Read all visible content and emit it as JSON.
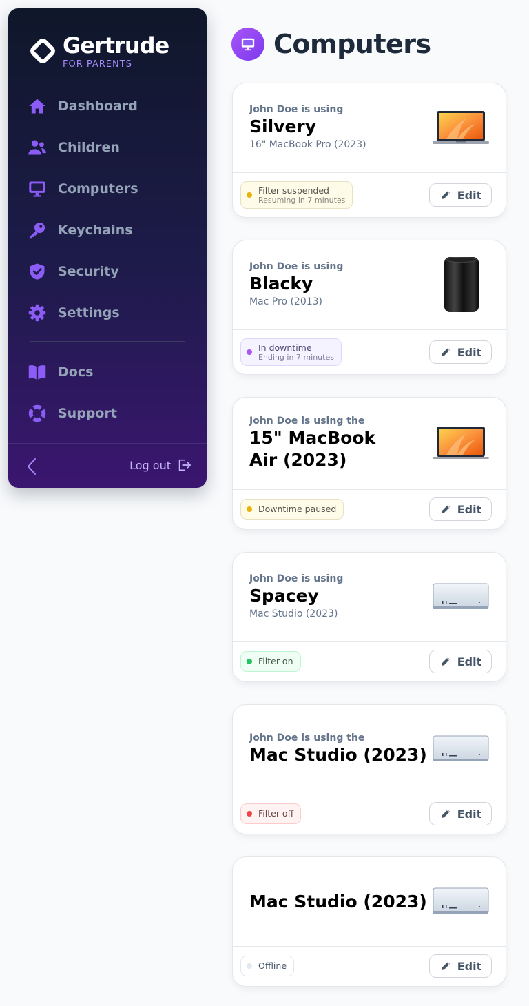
{
  "brand": {
    "name": "Gertrude",
    "tagline": "FOR PARENTS"
  },
  "nav": {
    "items": [
      {
        "label": "Dashboard",
        "icon": "home-icon"
      },
      {
        "label": "Children",
        "icon": "users-icon"
      },
      {
        "label": "Computers",
        "icon": "computer-icon"
      },
      {
        "label": "Keychains",
        "icon": "key-icon"
      },
      {
        "label": "Security",
        "icon": "shield-icon"
      },
      {
        "label": "Settings",
        "icon": "gear-icon"
      }
    ],
    "secondary": [
      {
        "label": "Docs",
        "icon": "book-icon"
      },
      {
        "label": "Support",
        "icon": "lifebuoy-icon"
      }
    ],
    "logout_label": "Log out"
  },
  "page": {
    "title": "Computers"
  },
  "computers": [
    {
      "using": "John Doe is using",
      "name": "Silvery",
      "model": "16\" MacBook Pro (2023)",
      "image": "macbook-pro-image",
      "status": {
        "title": "Filter suspended",
        "sub": "Resuming in 7 minutes",
        "color": "#eab308"
      },
      "edit_label": "Edit"
    },
    {
      "using": "John Doe is using",
      "name": "Blacky",
      "model": "Mac Pro (2013)",
      "image": "mac-pro-image",
      "status": {
        "title": "In downtime",
        "sub": "Ending in 7 minutes",
        "color": "#a855f7"
      },
      "edit_label": "Edit"
    },
    {
      "using": "John Doe is using the",
      "name": "15\" MacBook Air (2023)",
      "model": "",
      "image": "macbook-air-image",
      "status": {
        "title": "Downtime paused",
        "sub": "",
        "color": "#eab308"
      },
      "edit_label": "Edit"
    },
    {
      "using": "John Doe is using",
      "name": "Spacey",
      "model": "Mac Studio (2023)",
      "image": "mac-studio-image",
      "status": {
        "title": "Filter on",
        "sub": "",
        "color": "#22c55e"
      },
      "edit_label": "Edit"
    },
    {
      "using": "John Doe is using the",
      "name": "Mac Studio (2023)",
      "model": "",
      "image": "mac-studio-image",
      "status": {
        "title": "Filter off",
        "sub": "",
        "color": "#ef4444"
      },
      "edit_label": "Edit"
    },
    {
      "using": "",
      "name": "Mac Studio (2023)",
      "model": "",
      "image": "mac-studio-image",
      "status": {
        "title": "Offline",
        "sub": "",
        "color": "#e2e8f0"
      },
      "edit_label": "Edit"
    }
  ]
}
